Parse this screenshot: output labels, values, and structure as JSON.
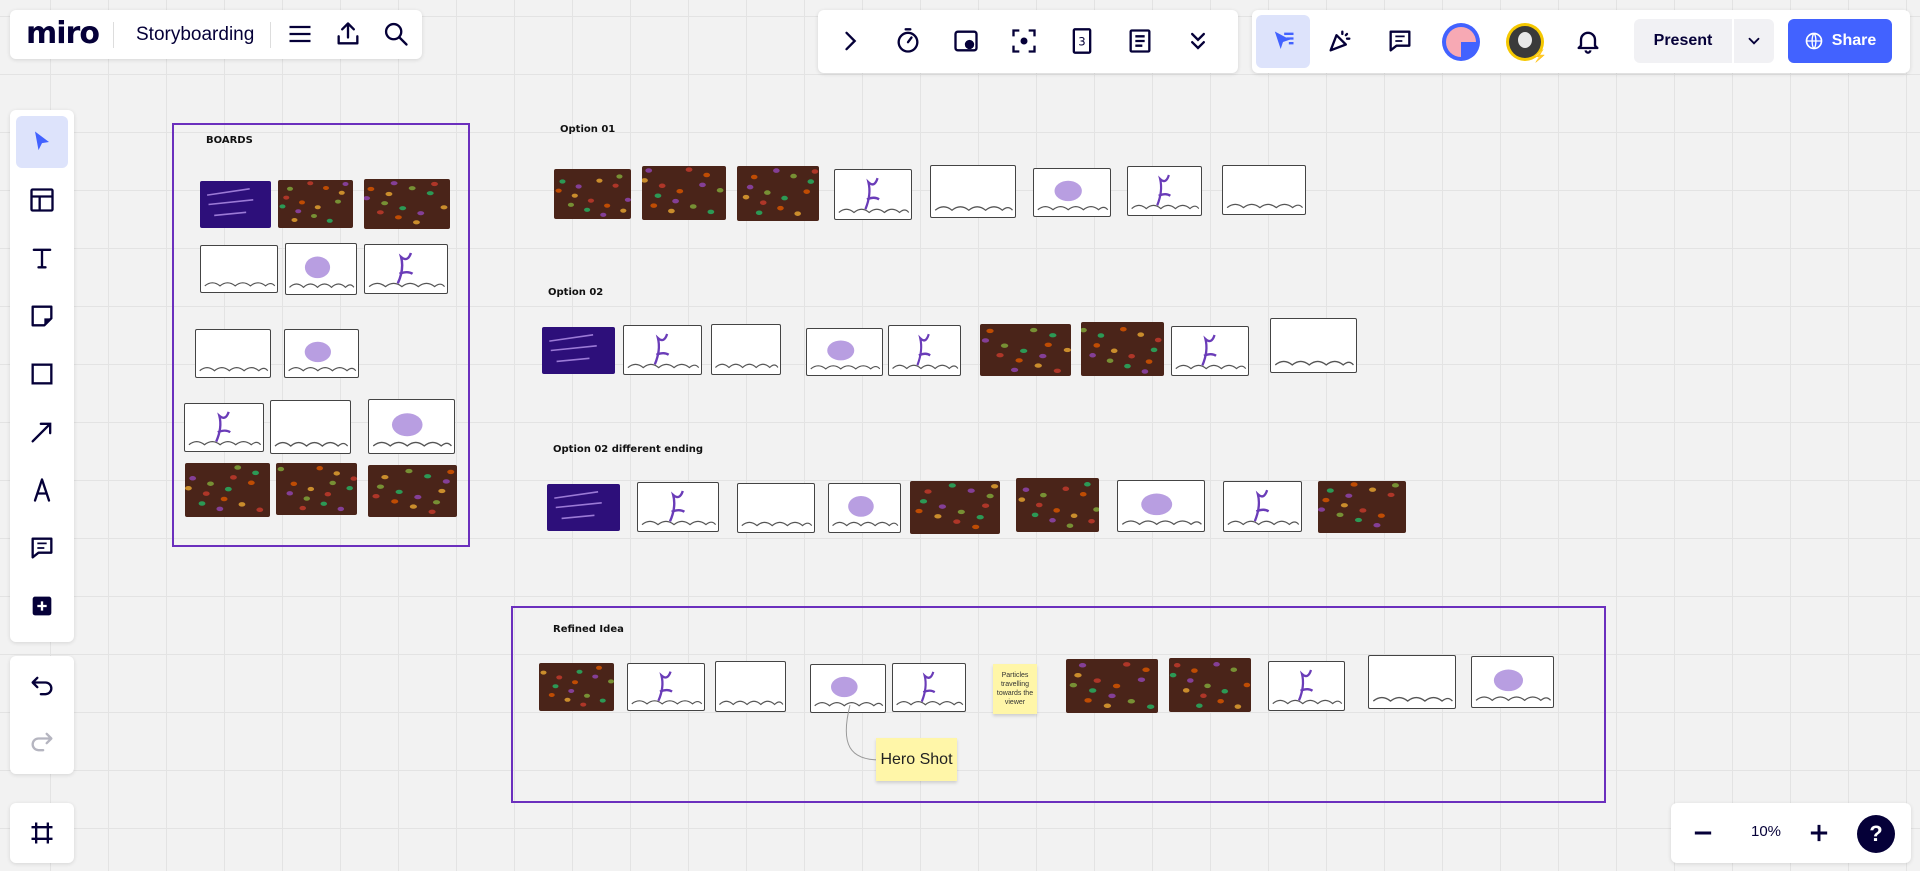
{
  "app": {
    "logo": "miro",
    "board_title": "Storyboarding"
  },
  "topbar": {
    "present_label": "Present",
    "share_label": "Share",
    "accent_color": "#4262ff"
  },
  "zoom": {
    "level": "10%"
  },
  "canvas": {
    "boards_frame_label": "BOARDS",
    "option01_label": "Option 01",
    "option02_label": "Option 02",
    "option02_diff_label": "Option 02 different ending",
    "refined_label": "Refined Idea",
    "sticky_particles": "Particles travelling towards the viewer",
    "sticky_hero": "Hero Shot",
    "frame_color": "#6b2fbd"
  }
}
